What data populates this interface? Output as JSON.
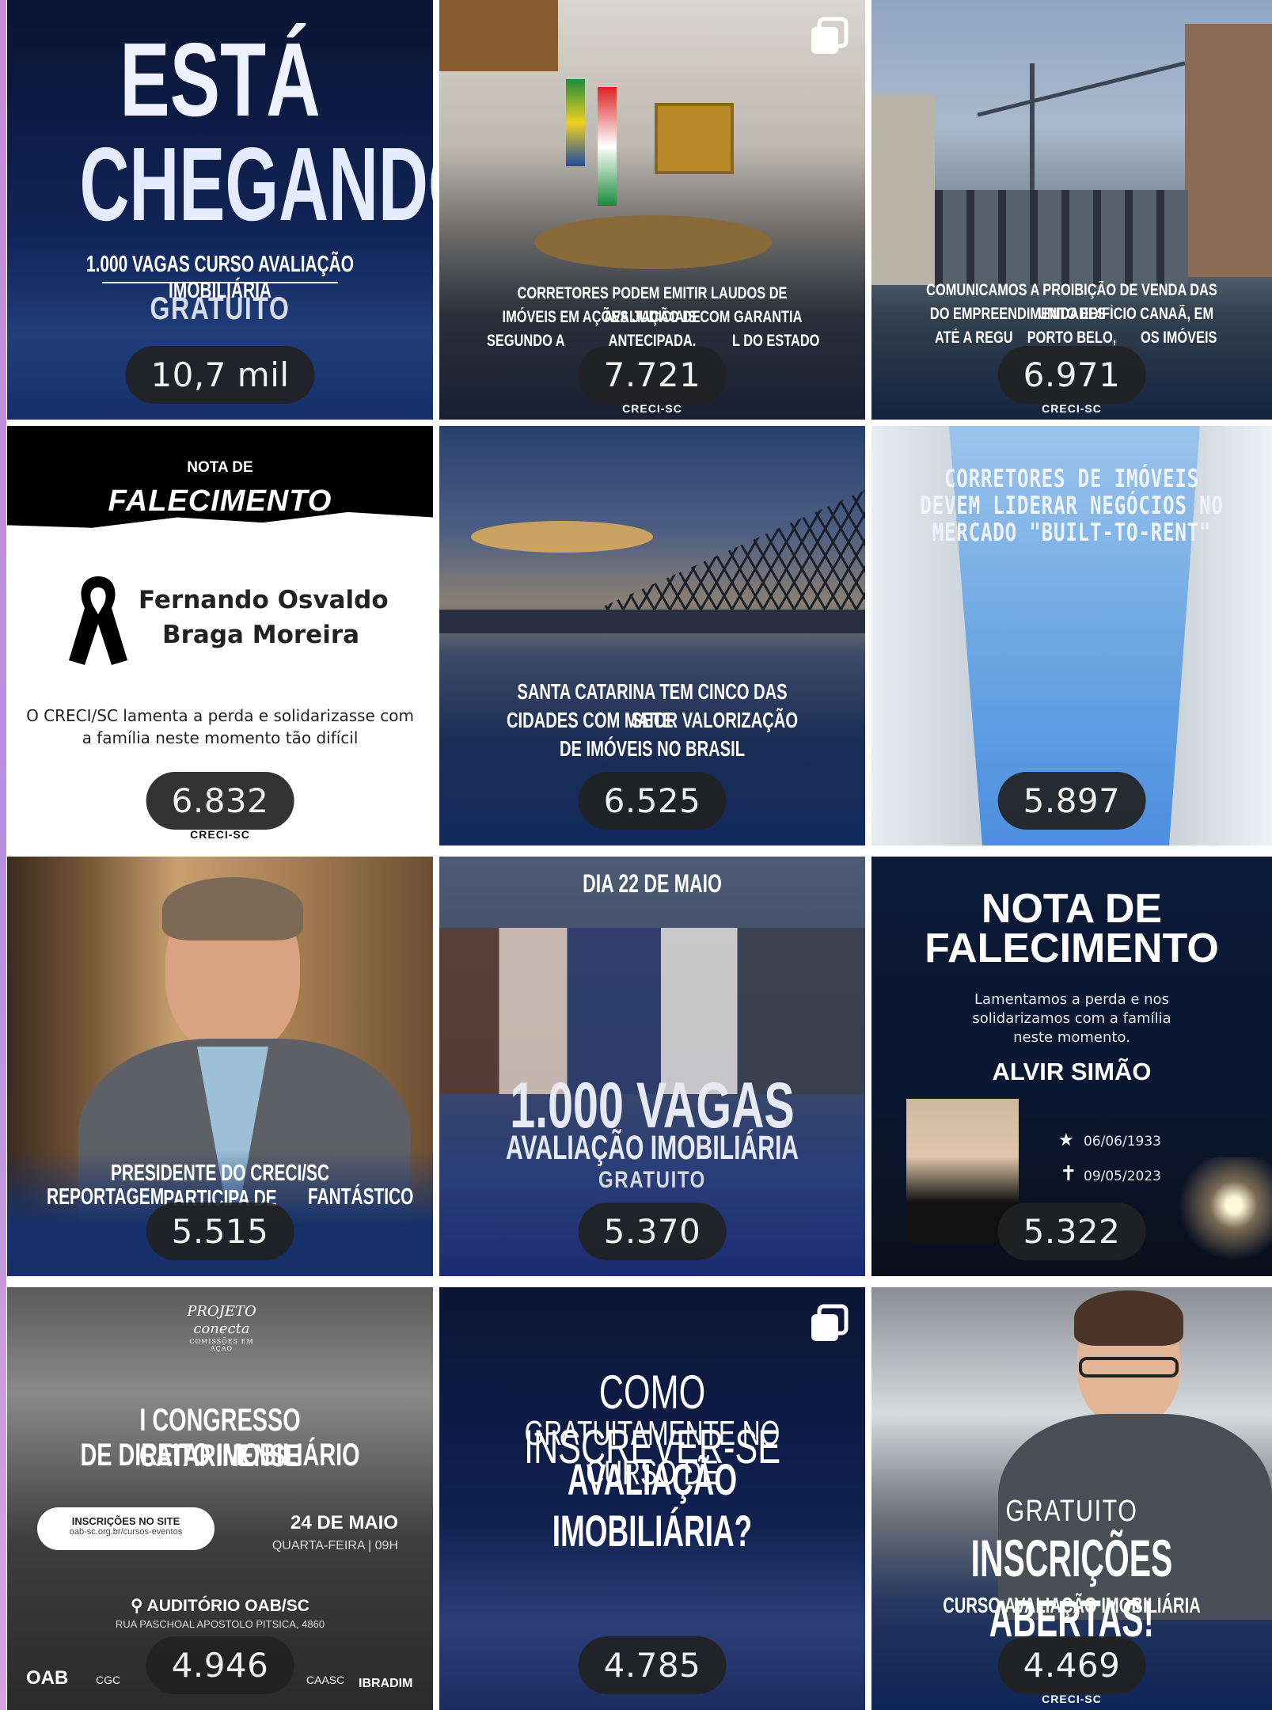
{
  "posts": [
    {
      "count": "10,7 mil",
      "headline": "ESTÁ",
      "headline2": "CHEGANDO",
      "sub": "1.000 VAGAS CURSO AVALIAÇÃO IMOBILIÁRIA",
      "tag": "GRATUITO"
    },
    {
      "count": "7.721",
      "caption": [
        "CORRETORES PODEM EMITIR LAUDOS DE AVALIAÇÃO DE",
        "IMÓVEIS EM AÇÕES JUDICIAIS COM GARANTIA ANTECIPADA,",
        "SEGUNDO A",
        "L DO ESTADO"
      ],
      "brand": "CRECI-SC"
    },
    {
      "count": "6.971",
      "caption": [
        "COMUNICAMOS A PROIBIÇÃO DE VENDA DAS UNIDADES",
        "DO EMPREENDIMENTO EDIFÍCIO CANAÃ, EM PORTO BELO,",
        "ATÉ A REGU",
        "OS IMÓVEIS"
      ],
      "brand": "CRECI-SC"
    },
    {
      "count": "6.832",
      "label_small": "NOTA DE",
      "label_big": "FALECIMENTO",
      "name1": "Fernando Osvaldo",
      "name2": "Braga Moreira",
      "msg1": "O CRECI/SC lamenta a perda e solidarizasse com",
      "msg2": "a família neste momento tão difícil",
      "brand": "CRECI-SC"
    },
    {
      "count": "6.525",
      "caption": [
        "SANTA CATARINA TEM CINCO DAS SETE",
        "CIDADES COM MAIOR VALORIZAÇÃO",
        "DE IMÓVEIS NO BRASIL"
      ]
    },
    {
      "count": "5.897",
      "caption": [
        "CORRETORES DE IMÓVEIS",
        "DEVEM LIDERAR NEGÓCIOS NO",
        "MERCADO \"BUILT-TO-RENT\""
      ]
    },
    {
      "count": "5.515",
      "caption": [
        "PRESIDENTE DO CRECI/SC PARTICIPA DE",
        "REPORTAGEM",
        "FANTÁSTICO"
      ]
    },
    {
      "count": "5.370",
      "date": "DIA 22 DE MAIO",
      "big": "1.000 VAGAS",
      "mid": "AVALIAÇÃO IMOBILIÁRIA",
      "tag": "GRATUITO"
    },
    {
      "count": "5.322",
      "title1": "NOTA DE",
      "title2": "FALECIMENTO",
      "msg": [
        "Lamentamos a perda e nos",
        "solidarizamos com a família",
        "neste momento."
      ],
      "name": "ALVIR SIMÃO",
      "born": "06/06/1933",
      "died": "09/05/2023"
    },
    {
      "count": "4.946",
      "logo": "PROJETO conecta",
      "logo_sub": "COMISSÕES EM AÇÃO",
      "title1": "I CONGRESSO CATARINENSE",
      "title2": "DE DIREITO IMOBILIÁRIO",
      "pill": "INSCRIÇÕES NO SITE",
      "pill_url": "oab-sc.org.br/cursos-eventos",
      "date": "24 DE MAIO",
      "weekday": "QUARTA-FEIRA | 09H",
      "venue": "AUDITÓRIO OAB/SC",
      "address": "RUA PASCHOAL APOSTOLO PITSICA, 4860",
      "sponsors": [
        "OAB",
        "CGC",
        "CAASC",
        "IBRADIM"
      ]
    },
    {
      "count": "4.785",
      "line1": "COMO INSCREVER-SE",
      "line2": "GRATUITAMENTE NO CURSO DE",
      "line3": "AVALIAÇÃO IMOBILIÁRIA?"
    },
    {
      "count": "4.469",
      "tag": "GRATUITO",
      "big": "INSCRIÇÕES ABERTAS!",
      "sub": "CURSO AVALIAÇÃO IMOBILIÁRIA",
      "brand": "CRECI-SC"
    }
  ],
  "icons": {
    "multi": "carousel-icon",
    "ribbon": "mourning-ribbon-icon",
    "pin": "location-pin-icon",
    "star": "star-icon",
    "cross": "cross-icon"
  },
  "colors": {
    "navy": "#0c1a3e",
    "count_bg": "#222222",
    "accent_strip": "#c98bd8"
  }
}
